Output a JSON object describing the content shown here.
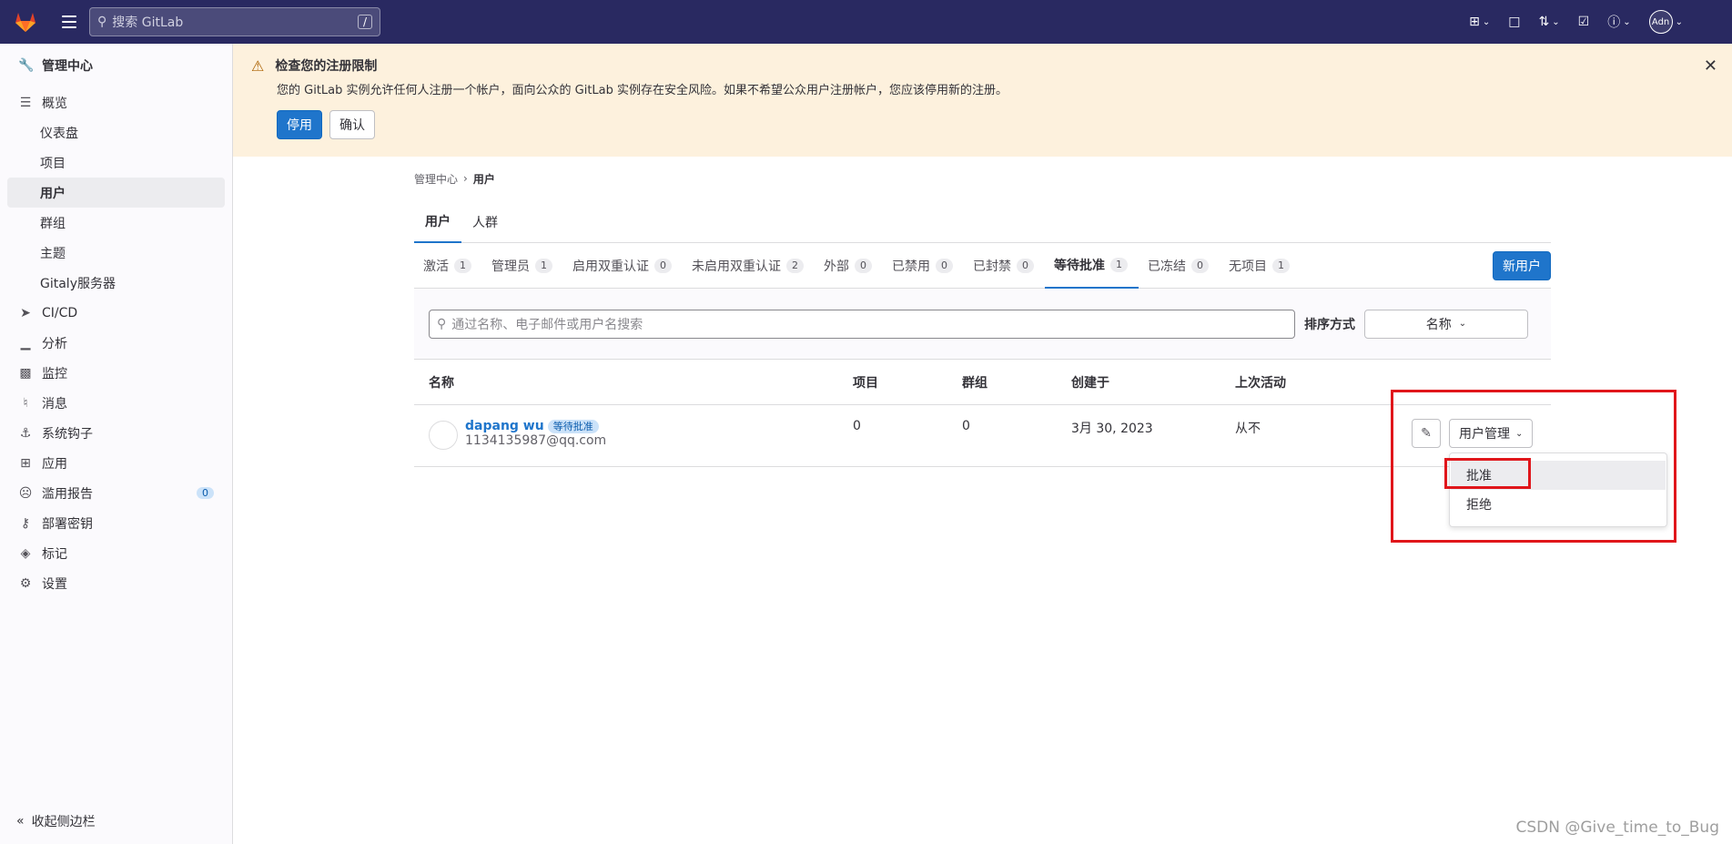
{
  "topbar": {
    "search_placeholder": "搜索 GitLab",
    "search_shortcut": "/",
    "avatar_text": "Adn"
  },
  "sidebar": {
    "header": "管理中心",
    "overview": "概览",
    "sub_items": [
      "仪表盘",
      "项目",
      "用户",
      "群组",
      "主题",
      "Gitaly服务器"
    ],
    "items": [
      "CI/CD",
      "分析",
      "监控",
      "消息",
      "系统钩子",
      "应用",
      "滥用报告",
      "部署密钥",
      "标记",
      "设置"
    ],
    "abuse_count": "0",
    "collapse": "收起侧边栏"
  },
  "alert": {
    "title": "检查您的注册限制",
    "body": "您的 GitLab 实例允许任何人注册一个帐户，面向公众的 GitLab 实例存在安全风险。如果不希望公众用户注册帐户，您应该停用新的注册。",
    "disable_label": "停用",
    "confirm_label": "确认"
  },
  "breadcrumb": {
    "parent": "管理中心",
    "sep": "›",
    "current": "用户"
  },
  "tabs_top": [
    "用户",
    "人群"
  ],
  "tabs_filter": [
    {
      "label": "激活",
      "count": "1"
    },
    {
      "label": "管理员",
      "count": "1"
    },
    {
      "label": "启用双重认证",
      "count": "0"
    },
    {
      "label": "未启用双重认证",
      "count": "2"
    },
    {
      "label": "外部",
      "count": "0"
    },
    {
      "label": "已禁用",
      "count": "0"
    },
    {
      "label": "已封禁",
      "count": "0"
    },
    {
      "label": "等待批准",
      "count": "1"
    },
    {
      "label": "已冻结",
      "count": "0"
    },
    {
      "label": "无项目",
      "count": "1"
    }
  ],
  "new_user_label": "新用户",
  "filter": {
    "placeholder": "通过名称、电子邮件或用户名搜索",
    "sort_label": "排序方式",
    "sort_value": "名称"
  },
  "table": {
    "headers": [
      "名称",
      "项目",
      "群组",
      "创建于",
      "上次活动"
    ],
    "row": {
      "name": "dapang wu",
      "badge": "等待批准",
      "email": "1134135987@qq.com",
      "projects": "0",
      "groups": "0",
      "created": "3月 30, 2023",
      "last_activity": "从不"
    }
  },
  "actions": {
    "manage_label": "用户管理",
    "menu": [
      "批准",
      "拒绝"
    ]
  },
  "watermark": "CSDN @Give_time_to_Bug",
  "colors": {
    "topbar": "#292961",
    "primary": "#1f75cb",
    "alert_bg": "#fdf1dd",
    "highlight": "#e0161b"
  }
}
